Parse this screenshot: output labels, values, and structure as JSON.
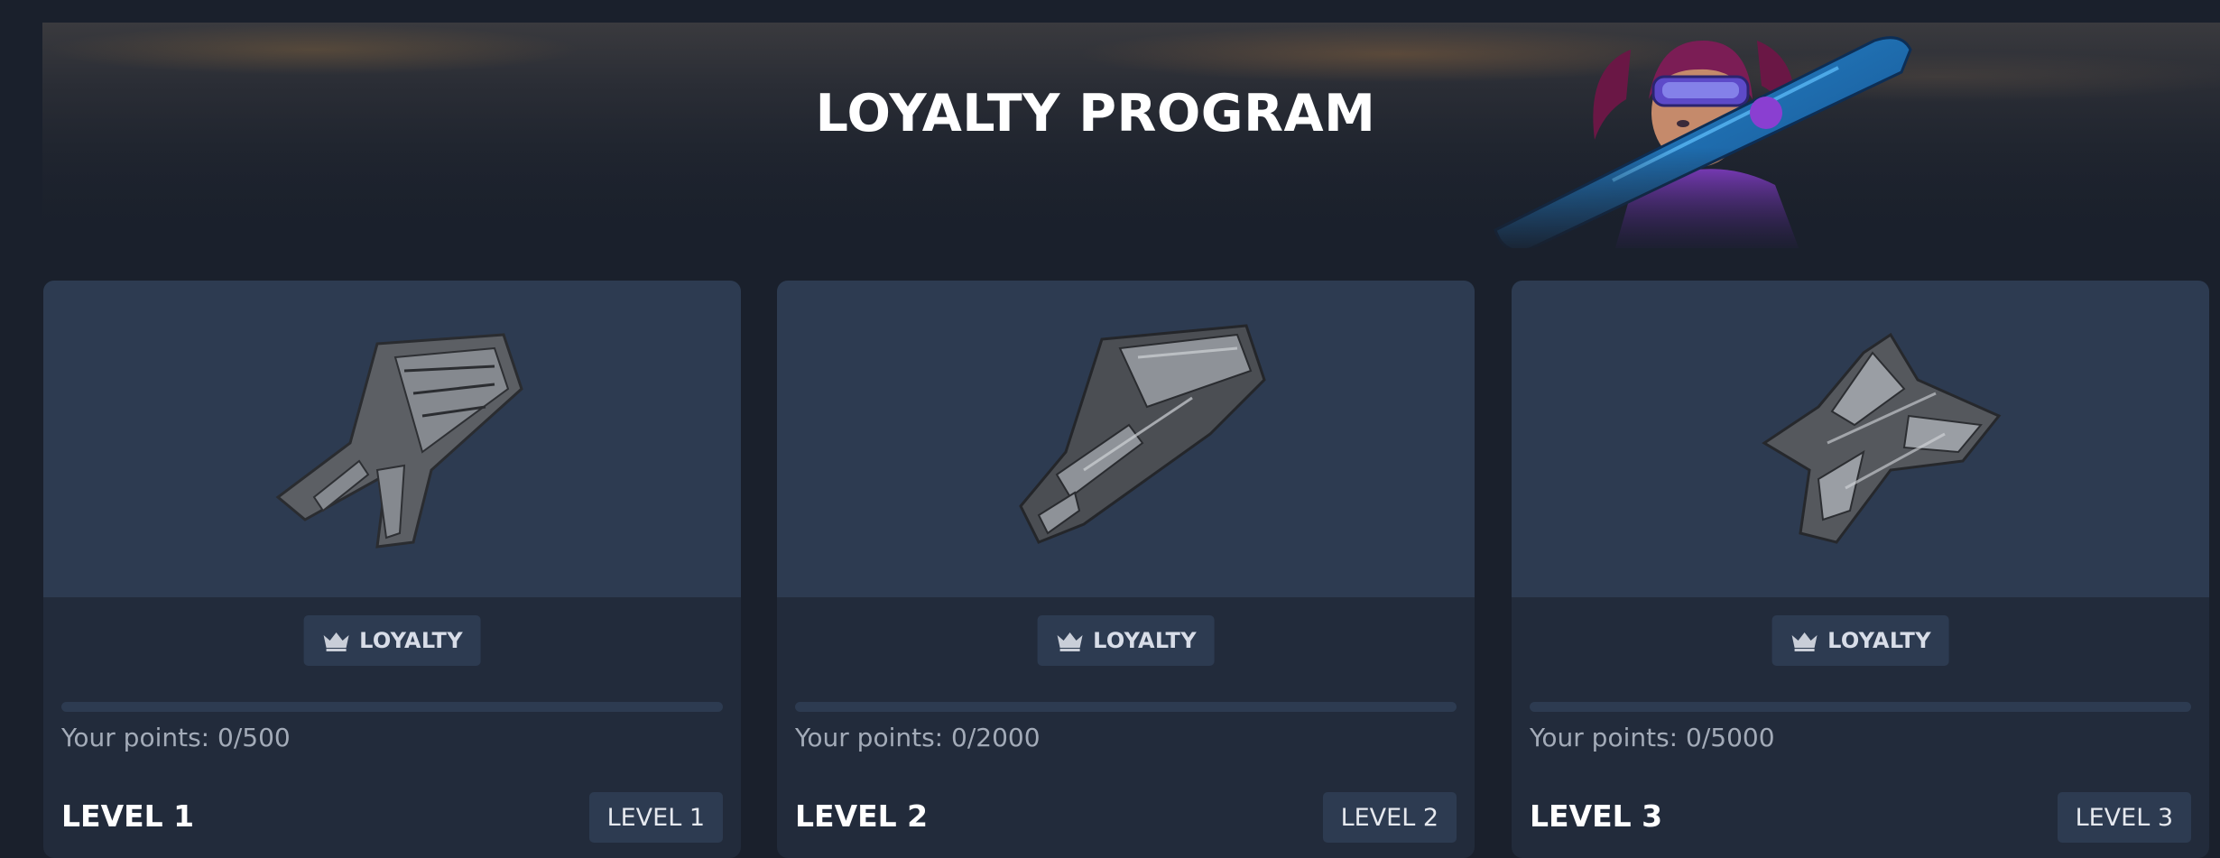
{
  "page": {
    "title": "LOYALTY PROGRAM"
  },
  "colors": {
    "background": "#1a202c",
    "card": "#222b3b",
    "card_image": "#2d3b51",
    "chip": "#2d3b51",
    "text_primary": "#ffffff",
    "text_secondary": "#a3abb8"
  },
  "cards": [
    {
      "ship_icon": "ship-icon",
      "badge": {
        "icon": "crown-icon",
        "label": "LOYALTY"
      },
      "points_text": "Your points: 0/500",
      "progress": 0,
      "level_title": "LEVEL 1",
      "level_button": "LEVEL 1"
    },
    {
      "ship_icon": "ship-icon",
      "badge": {
        "icon": "crown-icon",
        "label": "LOYALTY"
      },
      "points_text": "Your points: 0/2000",
      "progress": 0,
      "level_title": "LEVEL 2",
      "level_button": "LEVEL 2"
    },
    {
      "ship_icon": "ship-icon",
      "badge": {
        "icon": "crown-icon",
        "label": "LOYALTY"
      },
      "points_text": "Your points: 0/5000",
      "progress": 0,
      "level_title": "LEVEL 3",
      "level_button": "LEVEL 3"
    }
  ]
}
